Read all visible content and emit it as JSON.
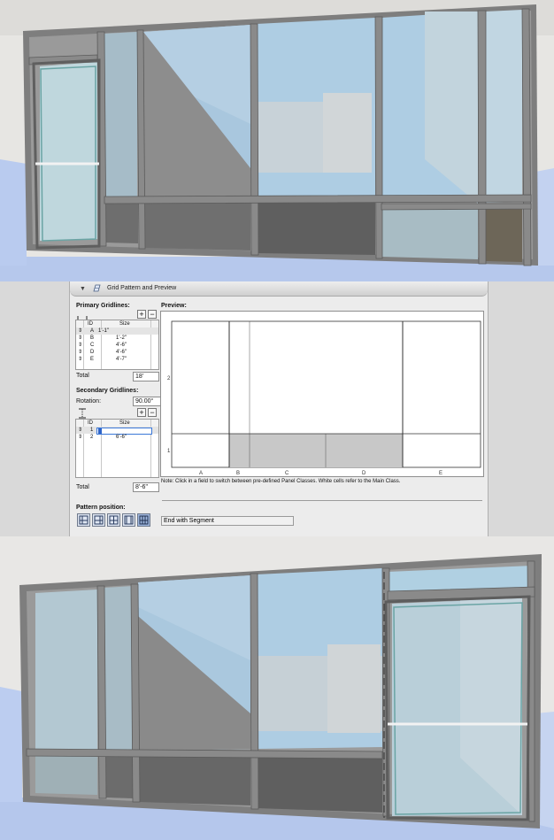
{
  "panel": {
    "title": "Grid Pattern and Preview",
    "collapse_icon": "triangle-down-icon",
    "panel_icon": "grid-pattern-icon"
  },
  "primary": {
    "label": "Primary Gridlines:",
    "columns": [
      "ID",
      "Size"
    ],
    "rows": [
      {
        "id": "A",
        "size": "1'-1\""
      },
      {
        "id": "B",
        "size": "1'-2\""
      },
      {
        "id": "C",
        "size": "4'-6\""
      },
      {
        "id": "D",
        "size": "4'-6\""
      },
      {
        "id": "E",
        "size": "4'-7\""
      }
    ],
    "total_label": "Total",
    "total_value": "18'"
  },
  "secondary": {
    "label": "Secondary Gridlines:",
    "rotation_label": "Rotation:",
    "rotation_value": "90.00°",
    "columns": [
      "ID",
      "Size"
    ],
    "rows": [
      {
        "id": "1",
        "size": ""
      },
      {
        "id": "2",
        "size": "6'-6\""
      }
    ],
    "total_label": "Total",
    "total_value": "8'-6\""
  },
  "preview": {
    "label": "Preview:",
    "column_labels": [
      "A",
      "B",
      "C",
      "D",
      "E"
    ],
    "row_labels": [
      "2",
      "1"
    ],
    "note": "Note: Click in a field to switch between pre-defined Panel Classes. White cells refer to the Main Class."
  },
  "pattern_position": {
    "label": "Pattern position:",
    "buttons": [
      "pattern-start-icon",
      "pattern-end-icon",
      "pattern-center-icon",
      "pattern-fit-icon",
      "pattern-end-segment-icon"
    ],
    "selected_value": "End with Segment"
  },
  "colors": {
    "sky": "#a9c8de",
    "frame": "#8a8a8a",
    "floor": "#b7c9ee",
    "grey_cell": "#c8c8c8"
  }
}
